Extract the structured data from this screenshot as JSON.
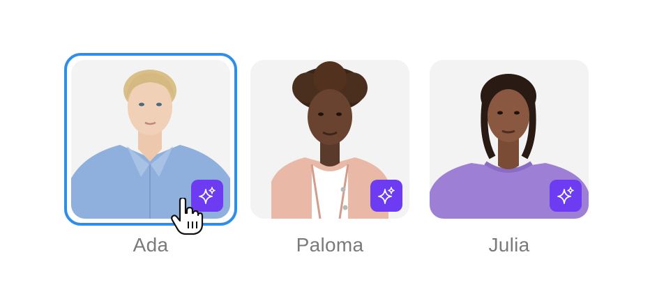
{
  "avatars": [
    {
      "name": "Ada",
      "selected": true,
      "badge_icon": "sparkle-icon"
    },
    {
      "name": "Paloma",
      "selected": false,
      "badge_icon": "sparkle-icon"
    },
    {
      "name": "Julia",
      "selected": false,
      "badge_icon": "sparkle-icon"
    }
  ],
  "colors": {
    "selection": "#2f8fe8",
    "badge": "#6d3cf2",
    "name_text": "#7a7a7a",
    "card_bg": "#f3f3f3"
  },
  "cursor_icon": "hand-pointer-icon"
}
